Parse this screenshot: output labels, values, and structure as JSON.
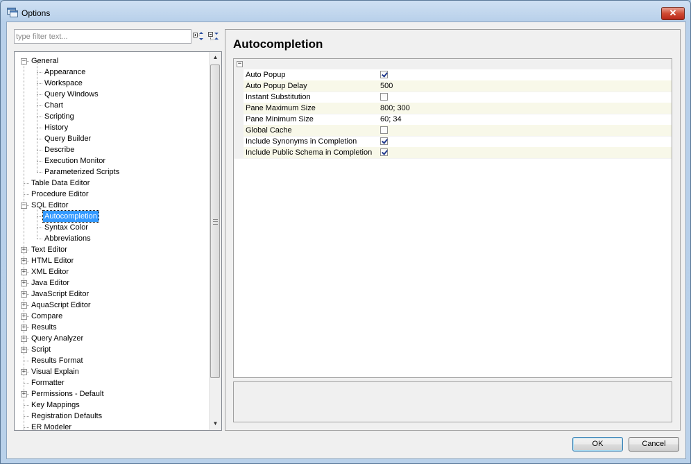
{
  "window": {
    "title": "Options"
  },
  "filter": {
    "placeholder": "type filter text..."
  },
  "tree": {
    "items": [
      {
        "label": "General",
        "level": 0,
        "expander": "minus"
      },
      {
        "label": "Appearance",
        "level": 1
      },
      {
        "label": "Workspace",
        "level": 1
      },
      {
        "label": "Query Windows",
        "level": 1
      },
      {
        "label": "Chart",
        "level": 1
      },
      {
        "label": "Scripting",
        "level": 1
      },
      {
        "label": "History",
        "level": 1
      },
      {
        "label": "Query Builder",
        "level": 1
      },
      {
        "label": "Describe",
        "level": 1
      },
      {
        "label": "Execution Monitor",
        "level": 1
      },
      {
        "label": "Parameterized Scripts",
        "level": 1
      },
      {
        "label": "Table Data Editor",
        "level": 0
      },
      {
        "label": "Procedure Editor",
        "level": 0
      },
      {
        "label": "SQL Editor",
        "level": 0,
        "expander": "minus"
      },
      {
        "label": "Autocompletion",
        "level": 1,
        "selected": true
      },
      {
        "label": "Syntax Color",
        "level": 1
      },
      {
        "label": "Abbreviations",
        "level": 1
      },
      {
        "label": "Text Editor",
        "level": 0,
        "expander": "plus"
      },
      {
        "label": "HTML Editor",
        "level": 0,
        "expander": "plus"
      },
      {
        "label": "XML Editor",
        "level": 0,
        "expander": "plus"
      },
      {
        "label": "Java Editor",
        "level": 0,
        "expander": "plus"
      },
      {
        "label": "JavaScript Editor",
        "level": 0,
        "expander": "plus"
      },
      {
        "label": "AquaScript Editor",
        "level": 0,
        "expander": "plus"
      },
      {
        "label": "Compare",
        "level": 0,
        "expander": "plus"
      },
      {
        "label": "Results",
        "level": 0,
        "expander": "plus"
      },
      {
        "label": "Query Analyzer",
        "level": 0,
        "expander": "plus"
      },
      {
        "label": "Script",
        "level": 0,
        "expander": "plus"
      },
      {
        "label": "Results Format",
        "level": 0
      },
      {
        "label": "Visual Explain",
        "level": 0,
        "expander": "plus"
      },
      {
        "label": "Formatter",
        "level": 0
      },
      {
        "label": "Permissions - Default",
        "level": 0,
        "expander": "plus"
      },
      {
        "label": "Key Mappings",
        "level": 0
      },
      {
        "label": "Registration Defaults",
        "level": 0
      },
      {
        "label": "ER Modeler",
        "level": 0
      }
    ]
  },
  "panel": {
    "title": "Autocompletion",
    "properties": [
      {
        "name": "Auto Popup",
        "type": "checkbox",
        "checked": true
      },
      {
        "name": "Auto Popup Delay",
        "type": "text",
        "value": "500"
      },
      {
        "name": "Instant Substitution",
        "type": "checkbox",
        "checked": false
      },
      {
        "name": "Pane Maximum Size",
        "type": "text",
        "value": "800; 300"
      },
      {
        "name": "Pane Minimum Size",
        "type": "text",
        "value": "60; 34"
      },
      {
        "name": "Global Cache",
        "type": "checkbox",
        "checked": false
      },
      {
        "name": "Include Synonyms in Completion",
        "type": "checkbox",
        "checked": true
      },
      {
        "name": "Include Public Schema in Completion",
        "type": "checkbox",
        "checked": true
      }
    ]
  },
  "buttons": {
    "ok": "OK",
    "cancel": "Cancel"
  },
  "icons": {
    "title": "options-window-icon",
    "close": "close-icon",
    "expand_all": "expand-all-icon",
    "collapse_all": "collapse-all-icon"
  }
}
